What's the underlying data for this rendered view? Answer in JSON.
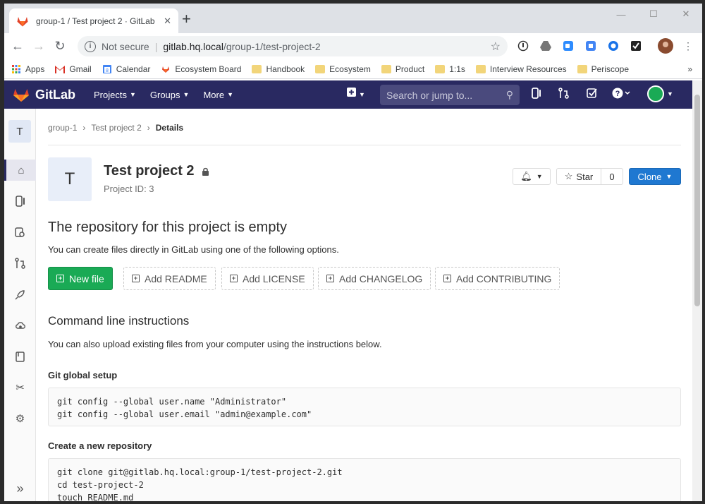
{
  "browser": {
    "tab_title": "group-1 / Test project 2 · GitLab",
    "not_secure": "Not secure",
    "url_host": "gitlab.hq.local",
    "url_path": "/group-1/test-project-2",
    "bookmarks": [
      {
        "label": "Apps",
        "icon": "apps-grid-icon"
      },
      {
        "label": "Gmail",
        "icon": "gmail-icon"
      },
      {
        "label": "Calendar",
        "icon": "calendar-icon"
      },
      {
        "label": "Ecosystem Board",
        "icon": "gitlab-icon"
      },
      {
        "label": "Handbook",
        "icon": "folder-icon"
      },
      {
        "label": "Ecosystem",
        "icon": "folder-icon"
      },
      {
        "label": "Product",
        "icon": "folder-icon"
      },
      {
        "label": "1:1s",
        "icon": "folder-icon"
      },
      {
        "label": "Interview Resources",
        "icon": "folder-icon"
      },
      {
        "label": "Periscope",
        "icon": "folder-icon"
      }
    ],
    "more_bookmarks": "»"
  },
  "gitlab_nav": {
    "brand": "GitLab",
    "menus": [
      "Projects",
      "Groups",
      "More"
    ],
    "search_placeholder": "Search or jump to..."
  },
  "sidebar": {
    "project_initial": "T",
    "items": [
      "home-icon",
      "issues-icon",
      "repository-icon",
      "merge-requests-icon",
      "ci-cd-icon",
      "operations-icon",
      "wiki-icon",
      "snippets-icon",
      "settings-icon"
    ],
    "collapse": "»"
  },
  "breadcrumb": {
    "items": [
      "group-1",
      "Test project 2",
      "Details"
    ]
  },
  "project": {
    "initial": "T",
    "name": "Test project 2",
    "id_label": "Project ID: 3",
    "star_label": "Star",
    "star_count": "0",
    "clone_label": "Clone"
  },
  "empty_repo": {
    "title": "The repository for this project is empty",
    "subtitle": "You can create files directly in GitLab using one of the following options.",
    "buttons": [
      "New file",
      "Add README",
      "Add LICENSE",
      "Add CHANGELOG",
      "Add CONTRIBUTING"
    ]
  },
  "cli": {
    "title": "Command line instructions",
    "subtitle": "You can also upload existing files from your computer using the instructions below.",
    "global_setup_title": "Git global setup",
    "global_setup_lines": [
      "git config --global user.name \"Administrator\"",
      "git config --global user.email \"admin@example.com\""
    ],
    "new_repo_title": "Create a new repository",
    "new_repo_lines": [
      "git clone git@gitlab.hq.local:group-1/test-project-2.git",
      "cd test-project-2",
      "touch README.md"
    ]
  },
  "colors": {
    "navbar": "#292961",
    "clone_button": "#1f78d1",
    "new_file_button": "#1aaa55"
  }
}
